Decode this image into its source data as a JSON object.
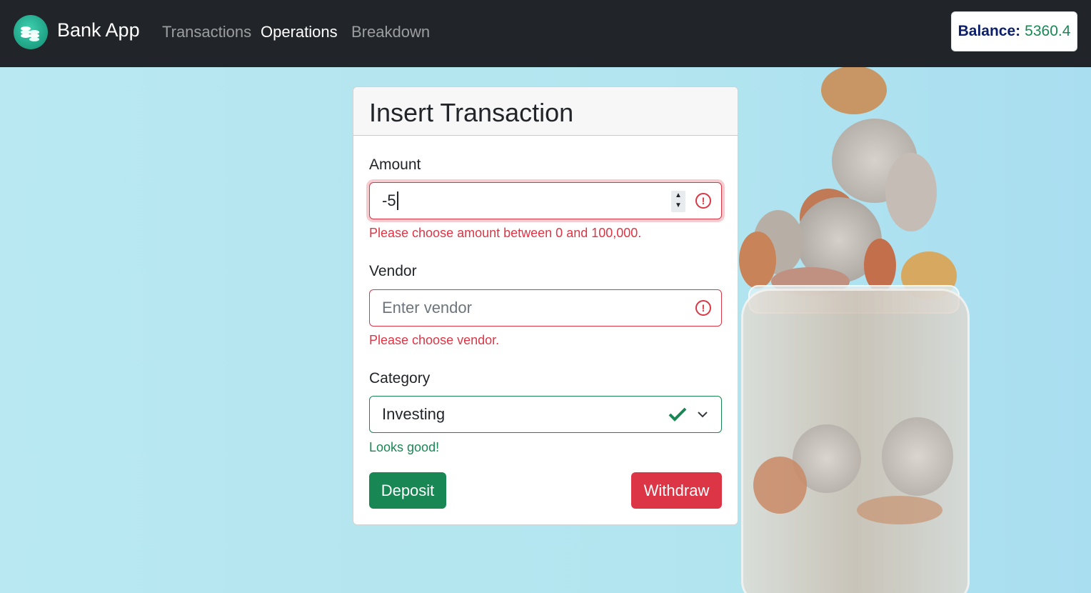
{
  "app": {
    "name": "Bank App",
    "nav": [
      {
        "label": "Transactions",
        "active": false
      },
      {
        "label": "Operations",
        "active": true
      },
      {
        "label": "Breakdown",
        "active": false
      }
    ],
    "balance_label": "Balance:",
    "balance_value": "5360.4"
  },
  "form": {
    "title": "Insert Transaction",
    "amount": {
      "label": "Amount",
      "value": "-5",
      "error": "Please choose amount between 0 and 100,000."
    },
    "vendor": {
      "label": "Vendor",
      "value": "",
      "placeholder": "Enter vendor",
      "error": "Please choose vendor."
    },
    "category": {
      "label": "Category",
      "selected": "Investing",
      "valid_message": "Looks good!"
    },
    "deposit_label": "Deposit",
    "withdraw_label": "Withdraw"
  },
  "colors": {
    "navbar": "#212529",
    "success": "#198754",
    "danger": "#dc3545",
    "balance_label": "#0b1f6b"
  }
}
